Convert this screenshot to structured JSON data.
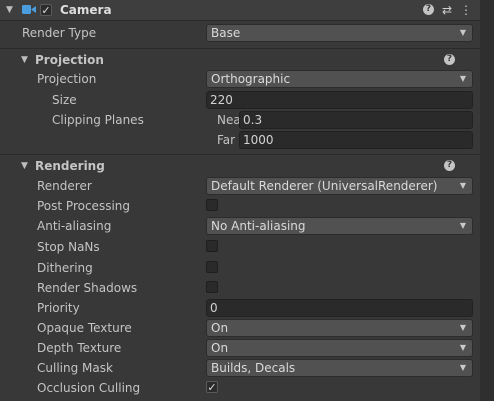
{
  "header": {
    "title": "Camera",
    "enabled": true,
    "icons": [
      "camera-icon",
      "help-icon",
      "preset-icon",
      "more-icon"
    ]
  },
  "render_type": {
    "label": "Render Type",
    "value": "Base"
  },
  "projection_section": {
    "title": "Projection",
    "projection": {
      "label": "Projection",
      "value": "Orthographic"
    },
    "size": {
      "label": "Size",
      "value": "220"
    },
    "clipping": {
      "label": "Clipping Planes",
      "near_label": "Near",
      "near_value": "0.3",
      "far_label": "Far",
      "far_value": "1000"
    }
  },
  "rendering_section": {
    "title": "Rendering",
    "renderer": {
      "label": "Renderer",
      "value": "Default Renderer (UniversalRenderer)"
    },
    "post_processing": {
      "label": "Post Processing",
      "checked": false
    },
    "anti_aliasing": {
      "label": "Anti-aliasing",
      "value": "No Anti-aliasing"
    },
    "stop_nans": {
      "label": "Stop NaNs",
      "checked": false
    },
    "dithering": {
      "label": "Dithering",
      "checked": false
    },
    "render_shadows": {
      "label": "Render Shadows",
      "checked": false
    },
    "priority": {
      "label": "Priority",
      "value": "0"
    },
    "opaque_texture": {
      "label": "Opaque Texture",
      "value": "On"
    },
    "depth_texture": {
      "label": "Depth Texture",
      "value": "On"
    },
    "culling_mask": {
      "label": "Culling Mask",
      "value": "Builds, Decals"
    },
    "occlusion_culling": {
      "label": "Occlusion Culling",
      "checked": true
    }
  },
  "glyphs": {
    "check": "✓",
    "help": "?",
    "arrow": "▼",
    "fold": "▼",
    "preset": "⇄",
    "more": "⋮"
  },
  "colors": {
    "camera_icon": "#4a9ee0",
    "background": "#383838",
    "field": "#2a2a2a",
    "dropdown": "#515151"
  }
}
